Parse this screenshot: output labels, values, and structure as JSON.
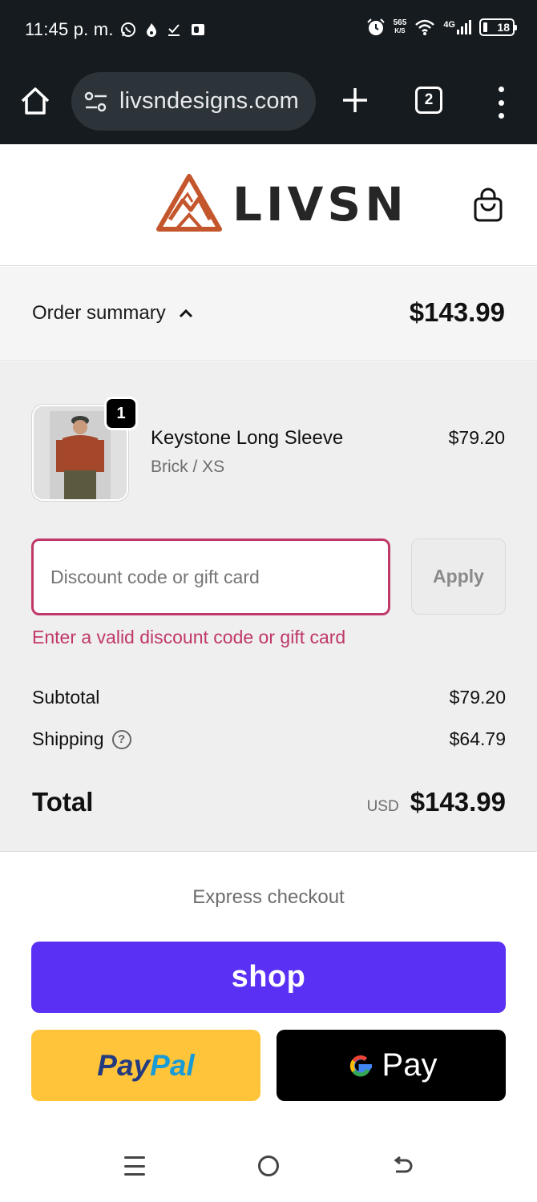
{
  "status_bar": {
    "time": "11:45 p. m.",
    "net_speed_value": "565",
    "net_speed_unit": "K/S",
    "network": "4G",
    "battery": "18",
    "left_icons": [
      "whatsapp-icon",
      "fire-icon",
      "check-icon",
      "outlook-icon"
    ],
    "right_icons": [
      "alarm-icon",
      "wifi-icon",
      "signal-icon",
      "battery-icon"
    ]
  },
  "browser": {
    "url": "livsndesigns.com",
    "tab_count": "2"
  },
  "header": {
    "brand": "LIVSN"
  },
  "order_summary": {
    "toggle_label": "Order summary",
    "header_total": "$143.99",
    "item": {
      "name": "Keystone Long Sleeve",
      "variant": "Brick / XS",
      "price": "$79.20",
      "quantity": "1"
    },
    "discount": {
      "placeholder": "Discount code or gift card",
      "apply_label": "Apply",
      "error": "Enter a valid discount code or gift card"
    },
    "subtotal_label": "Subtotal",
    "subtotal_value": "$79.20",
    "shipping_label": "Shipping",
    "shipping_value": "$64.79",
    "total_label": "Total",
    "currency": "USD",
    "total_value": "$143.99"
  },
  "express": {
    "title": "Express checkout",
    "shop_label": "shop",
    "paypal_part1": "Pay",
    "paypal_part2": "Pal",
    "gpay_label": "Pay"
  },
  "colors": {
    "accent_error": "#c0386a",
    "shop_purple": "#5a31f4",
    "paypal_yellow": "#ffc439",
    "brand_orange": "#c4562d"
  }
}
